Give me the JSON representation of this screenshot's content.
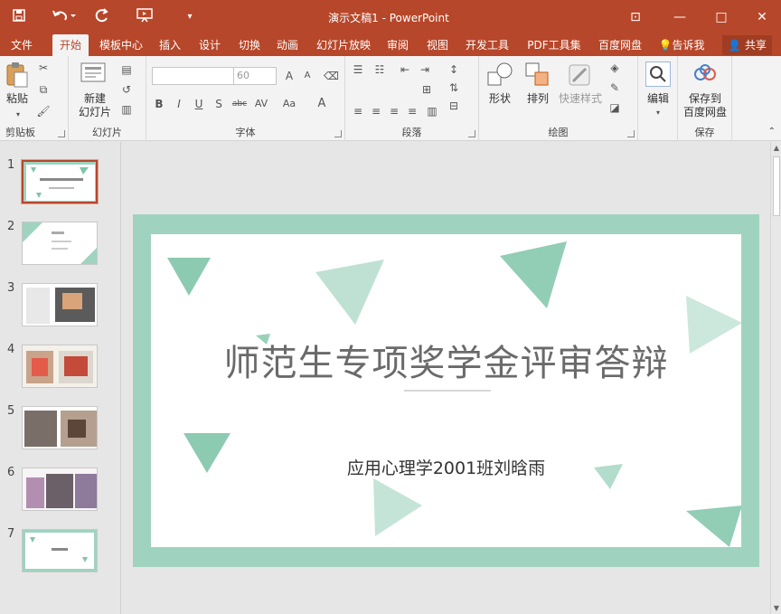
{
  "window": {
    "title": "演示文稿1 - PowerPoint",
    "minimize_glyph": "—",
    "restore_glyph": "□",
    "close_glyph": "✕",
    "ribbon_options_glyph": "⊡"
  },
  "quick_access": {
    "save_icon": "save-icon",
    "undo_icon": "undo-icon",
    "redo_icon": "redo-icon",
    "present_icon": "present-icon"
  },
  "menu": {
    "tabs": [
      "文件",
      "开始",
      "模板中心",
      "插入",
      "设计",
      "切换",
      "动画",
      "幻灯片放映",
      "审阅",
      "视图",
      "开发工具",
      "PDF工具集",
      "百度网盘"
    ],
    "tell_me": "告诉我",
    "share": "共享"
  },
  "ribbon": {
    "clipboard": {
      "paste": "粘贴",
      "label": "剪贴板"
    },
    "slides": {
      "new_slide_line1": "新建",
      "new_slide_line2": "幻灯片",
      "label": "幻灯片"
    },
    "font": {
      "name_value": "",
      "size_value": "60",
      "label": "字体",
      "bold": "B",
      "italic": "I",
      "underline": "U",
      "strike": "S",
      "shadow": "abc",
      "char_spacing": "AV",
      "case": "Aa",
      "font_color": "A",
      "grow": "A",
      "shrink": "A"
    },
    "paragraph": {
      "label": "段落"
    },
    "drawing": {
      "shapes": "形状",
      "arrange": "排列",
      "quick_styles": "快速样式",
      "label": "绘图"
    },
    "editing": {
      "label": "编辑"
    },
    "save": {
      "save_line1": "保存到",
      "save_line2": "百度网盘",
      "label": "保存"
    }
  },
  "thumbnails": [
    {
      "num": "1"
    },
    {
      "num": "2"
    },
    {
      "num": "3"
    },
    {
      "num": "4"
    },
    {
      "num": "5"
    },
    {
      "num": "6"
    },
    {
      "num": "7"
    }
  ],
  "slide": {
    "title": "师范生专项奖学金评审答辩",
    "subtitle": "应用心理学2001班刘晗雨",
    "border_color": "#9fd3bf",
    "accent_color": "#7fc4a8"
  },
  "colors": {
    "brand": "#b7472a",
    "ribbon_bg": "#f3f3f3"
  }
}
